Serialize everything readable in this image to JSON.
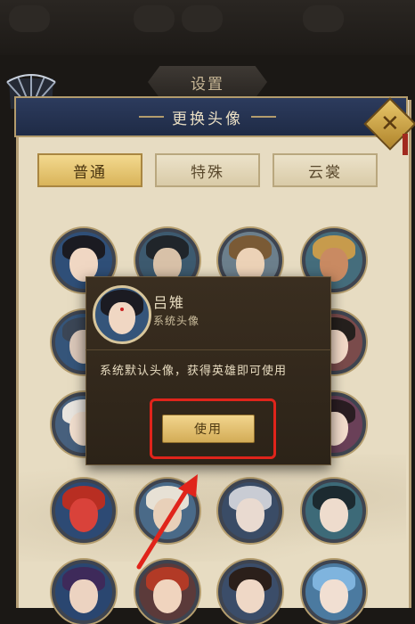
{
  "window": {
    "settings_tab": "设置"
  },
  "panel": {
    "title": "更换头像"
  },
  "tabs": [
    {
      "label": "普通",
      "active": true
    },
    {
      "label": "特殊",
      "active": false
    },
    {
      "label": "云裳",
      "active": false
    }
  ],
  "popup": {
    "hero_name": "吕雉",
    "hero_type": "系统头像",
    "description": "系统默认头像，获得英雄即可使用",
    "use_label": "使用"
  },
  "colors": {
    "header_navy": "#22304d",
    "panel_parchment": "#e7dcc2",
    "gold_button": "#d9b45a",
    "highlight_red": "#e0241b"
  },
  "icons": {
    "close": "close-x-icon",
    "fan": "fan-decoration-icon"
  }
}
